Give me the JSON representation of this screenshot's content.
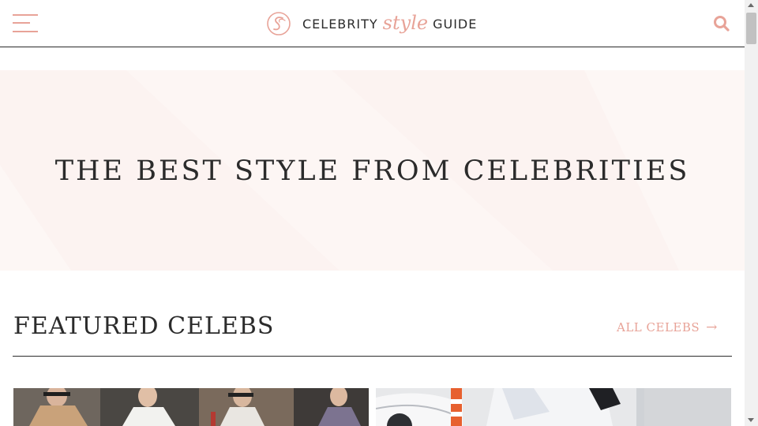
{
  "header": {
    "logo": {
      "word1": "CELEBRITY",
      "word2": "style",
      "word3": "GUIDE"
    },
    "menu_icon": "hamburger-menu-icon",
    "search_icon": "search-icon"
  },
  "hero": {
    "title": "THE BEST STYLE FROM CELEBRITIES"
  },
  "featured": {
    "title": "FEATURED CELEBS",
    "all_link_label": "ALL CELEBS",
    "all_link_arrow": "→"
  },
  "colors": {
    "accent": "#e8a398",
    "text": "#2b2b2b",
    "hero_bg": "#fcf3f1",
    "divider": "#2b2b2b"
  }
}
